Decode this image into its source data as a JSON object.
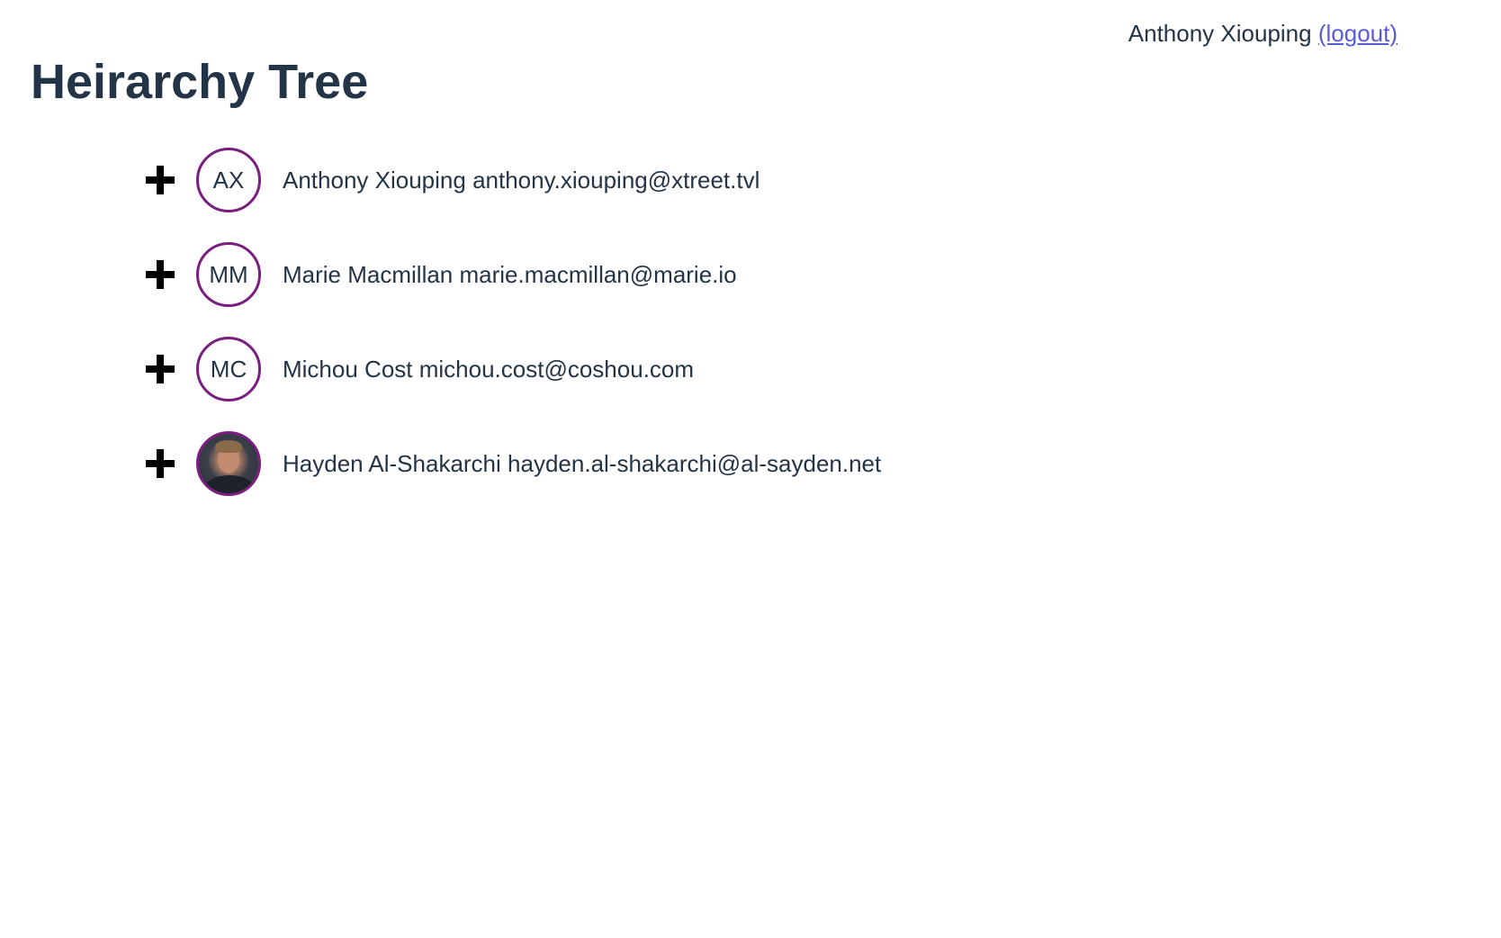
{
  "header": {
    "user_name": "Anthony Xiouping",
    "logout_label": "(logout)"
  },
  "page": {
    "title": "Heirarchy Tree"
  },
  "tree": {
    "items": [
      {
        "initials": "AX",
        "name": "Anthony Xiouping",
        "email": "anthony.xiouping@xtreet.tvl",
        "has_photo": false
      },
      {
        "initials": "MM",
        "name": "Marie Macmillan",
        "email": "marie.macmillan@marie.io",
        "has_photo": false
      },
      {
        "initials": "MC",
        "name": "Michou Cost",
        "email": "michou.cost@coshou.com",
        "has_photo": false
      },
      {
        "initials": "",
        "name": "Hayden Al-Shakarchi",
        "email": "hayden.al-shakarchi@al-sayden.net",
        "has_photo": true
      }
    ]
  },
  "colors": {
    "text": "#243447",
    "avatar_border": "#7a1f7f",
    "link": "#5b5bd6",
    "icon": "#000000"
  }
}
